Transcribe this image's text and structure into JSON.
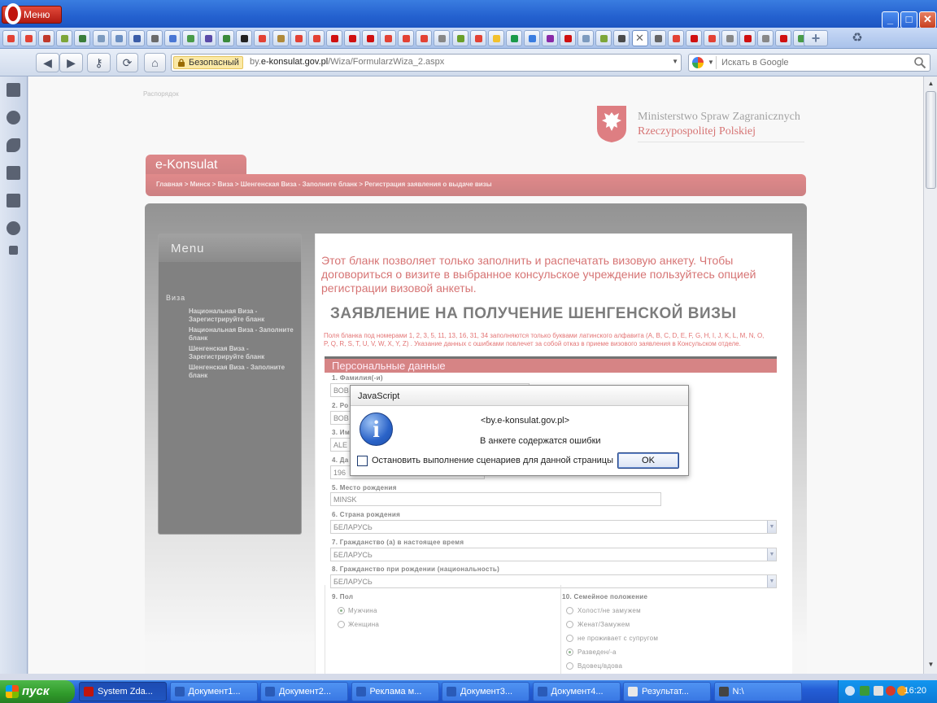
{
  "browser": {
    "menu_label": "Меню",
    "window_buttons": {
      "minimize": "_",
      "maximize": "□",
      "close": "✕"
    },
    "tab_close_glyph": "✕",
    "tab_add_glyph": "+",
    "trash_glyph": "♻",
    "address": {
      "security_label": "Безопасный",
      "url_host": "e-konsulat.gov.pl",
      "url_prefix": "by.",
      "url_path": "/Wiza/FormularzWiza_2.aspx",
      "dropdown_glyph": "▼"
    },
    "search": {
      "placeholder": "Искать в Google",
      "dropdown_glyph": "▼"
    },
    "nav": {
      "back": "◀",
      "forward": "▶",
      "key": "⚷",
      "reload": "⟳",
      "home": "⌂"
    }
  },
  "page": {
    "top_link": "Распорядок",
    "logo_line1": "Ministerstwo Spraw Zagranicznych",
    "logo_line2": "Rzeczypospolitej Polskiej",
    "site_tab": "e-Konsulat",
    "breadcrumb": "Главная > Минск > Виза > Шенгенская Виза - Заполните бланк > Регистрация заявления о выдаче визы",
    "menu": {
      "title": "Menu",
      "section": "Виза",
      "items": [
        "Национальная Виза - Зарегистрируйте бланк",
        "Национальная Виза - Заполните бланк",
        "Шенгенская Виза - Зарегистрируйте бланк",
        "Шенгенская Виза - Заполните бланк"
      ]
    },
    "notice": "Этот бланк позволяет только заполнить и распечатать визовую анкету. Чтобы договориться о визите в выбранное консульское учреждение пользуйтесь опцией регистрации визовой анкеты.",
    "form_title": "ЗАЯВЛЕНИЕ НА ПОЛУЧЕНИЕ ШЕНГЕНСКОЙ ВИЗЫ",
    "form_note": "Поля бланка под номерами 1, 2, 3, 5, 11, 13, 16, 31, 34 заполняются только буквами латинского алфавита (A, B, C, D, E, F, G, H, I, J, K, L, M, N, O, P, Q, R, S, T, U, V, W, X, Y, Z) . Указание данных с ошибками повлечет за собой отказ в приеме визового заявления в Консульском отделе.",
    "section": "Персональные данные",
    "fields": {
      "f1_label": "1. Фамилия(-и)",
      "f1_value": "ВОВ",
      "f2_label": "2. Ро",
      "f2_value": "ВОВ",
      "f3_label": "3. Им",
      "f3_value": "ALE",
      "f4_label": "4. Да",
      "f4_value": "196",
      "f5_label": "5. Место рождения",
      "f5_value": "MINSK",
      "f6_label": "6. Страна рождения",
      "f6_value": "БЕЛАРУСЬ",
      "f7_label": "7. Гражданство (а) в настоящее время",
      "f7_value": "БЕЛАРУСЬ",
      "f8_label": "8. Гражданство при рождении (национальность)",
      "f8_value": "БЕЛАРУСЬ",
      "f9_label": "9. Пол",
      "f9_options": [
        "Мужчина",
        "Женщина"
      ],
      "f9_selected": 0,
      "f10_label": "10. Семейное положение",
      "f10_options": [
        "Холост/не замужем",
        "Женат/Замужем",
        "не проживает с супругом",
        "Разведен/-а",
        "Вдовец/вдова"
      ],
      "f10_selected": 3,
      "select_glyph": "▼"
    }
  },
  "dialog": {
    "title": "JavaScript",
    "icon": "i",
    "host": "<by.e-konsulat.gov.pl>",
    "message": "В анкете содержатся ошибки",
    "checkbox_label": "Остановить выполнение сценариев для данной страницы",
    "checkbox_checked": false,
    "ok_label": "OK"
  },
  "taskbar": {
    "start_label": "пуск",
    "tasks": [
      "System Zda...",
      "Документ1...",
      "Документ2...",
      "Реклама м...",
      "Документ3...",
      "Документ4...",
      "Результат...",
      "N:\\"
    ],
    "active_task": 0,
    "clock": "16:20"
  },
  "colors": {
    "brand_red": "#b41f22",
    "opera_red": "#c0150d",
    "xp_blue": "#245ed6",
    "start_green": "#2f9a2a"
  },
  "icons": {
    "tab_favicons": [
      "#e34234",
      "#e34234",
      "#c0392b",
      "#7da63a",
      "#3a7d3a",
      "#7d9bbf",
      "#6b8fc2",
      "#3b5da8",
      "#6b6b6b",
      "#4a77d4",
      "#4a9c4a",
      "#5a4aa8",
      "#3a8a3a",
      "#222222",
      "#e34234",
      "#b08a3a",
      "#e34234",
      "#e34234",
      "#d01010",
      "#d01010",
      "#d01010",
      "#e34234",
      "#e34234",
      "#e34234",
      "#888888",
      "#6aa02a",
      "#e34234",
      "#f2c12e",
      "#1a9a4a",
      "#3a7de0",
      "#8a2aa8",
      "#d01010",
      "#7d9bbf",
      "#7da63a",
      "#4a4a4a",
      "#666666",
      "#e34234",
      "#d01010",
      "#e34234",
      "#888888",
      "#d01010",
      "#888888",
      "#d01010",
      "#4a9c4a"
    ],
    "side_panel": [
      "bookmarks-icon",
      "widgets-icon",
      "feeds-icon",
      "notes-icon",
      "downloads-icon",
      "history-icon",
      "add-panel-icon"
    ]
  }
}
